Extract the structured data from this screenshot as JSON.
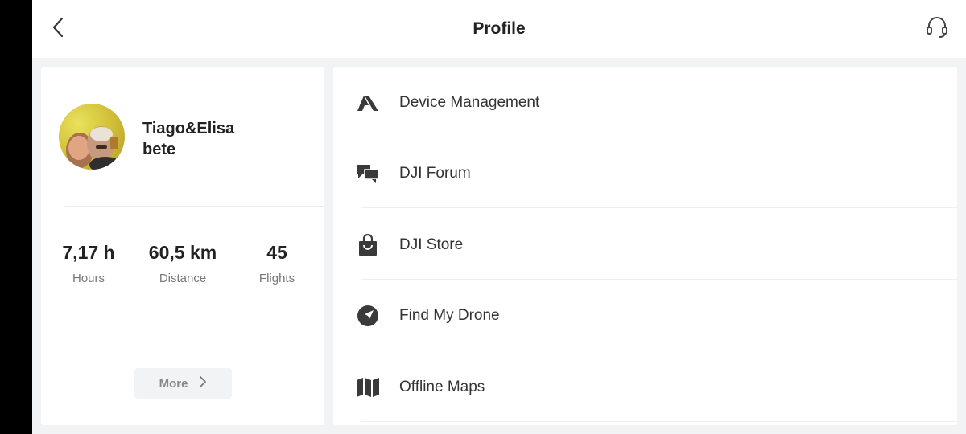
{
  "header": {
    "title": "Profile",
    "back_icon": "chevron-left-icon",
    "support_icon": "headset-icon"
  },
  "profile": {
    "name_line1": "Tiago&Elisa",
    "name_line2": "bete",
    "stats": {
      "hours": {
        "value": "7,17 h",
        "label": "Hours"
      },
      "distance": {
        "value": "60,5 km",
        "label": "Distance"
      },
      "flights": {
        "value": "45",
        "label": "Flights"
      }
    },
    "more_label": "More"
  },
  "menu": {
    "items": [
      {
        "label": "Device Management",
        "icon": "device-management-icon"
      },
      {
        "label": "DJI Forum",
        "icon": "forum-chat-icon"
      },
      {
        "label": "DJI Store",
        "icon": "shopping-bag-icon"
      },
      {
        "label": "Find My Drone",
        "icon": "compass-navigation-icon"
      },
      {
        "label": "Offline Maps",
        "icon": "map-icon"
      }
    ]
  },
  "colors": {
    "background": "#f2f3f5",
    "card": "#ffffff",
    "text_primary": "#222222",
    "text_secondary": "#777777",
    "icon": "#3a3a3a"
  }
}
